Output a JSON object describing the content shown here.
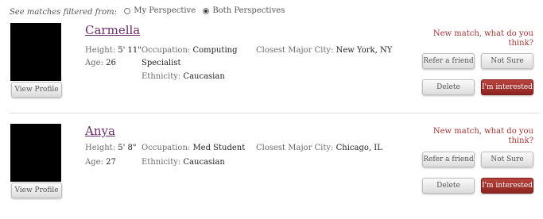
{
  "filter": {
    "label": "See matches filtered from:",
    "options": [
      {
        "label": "My Perspective",
        "selected": false
      },
      {
        "label": "Both Perspectives",
        "selected": true
      }
    ]
  },
  "labels": {
    "height": "Height:",
    "age": "Age:",
    "occupation": "Occupation:",
    "ethnicity": "Ethnicity:",
    "city": "Closest Major City:",
    "view_profile": "View Profile",
    "prompt": "New match, what do you think?",
    "refer": "Refer a friend",
    "not_sure": "Not Sure",
    "delete": "Delete",
    "interested": "I'm interested"
  },
  "matches": [
    {
      "name": "Carmella",
      "height": "5' 11\"",
      "age": "26",
      "occupation_line1": "Computing",
      "occupation_line2": "Specialist",
      "ethnicity": "Caucasian",
      "city": "New York, NY"
    },
    {
      "name": "Anya",
      "height": "5' 8\"",
      "age": "27",
      "occupation_line1": "Med Student",
      "occupation_line2": "",
      "ethnicity": "Caucasian",
      "city": "Chicago, IL"
    }
  ],
  "colors": {
    "name_link": "#6a2f6c",
    "prompt_text": "#a23535",
    "primary_button": "#a3302b"
  }
}
